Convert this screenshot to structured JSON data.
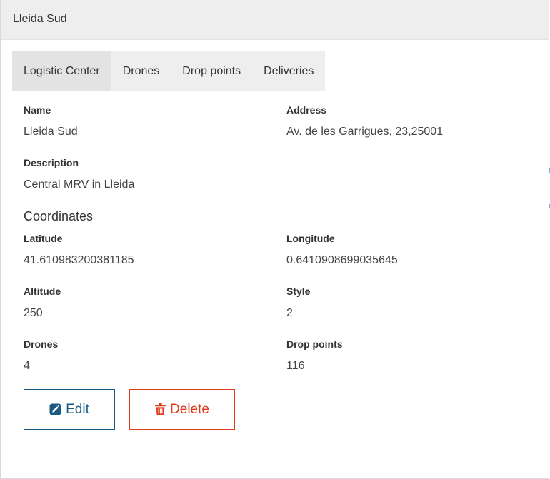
{
  "panel": {
    "title": "Lleida Sud"
  },
  "tabs": [
    {
      "label": "Logistic Center",
      "active": true
    },
    {
      "label": "Drones",
      "active": false
    },
    {
      "label": "Drop points",
      "active": false
    },
    {
      "label": "Deliveries",
      "active": false
    }
  ],
  "details": {
    "name_label": "Name",
    "name_value": "Lleida Sud",
    "address_label": "Address",
    "address_value": "Av. de les Garrigues, 23,25001",
    "description_label": "Description",
    "description_value": "Central MRV in Lleida"
  },
  "coordinates": {
    "section_title": "Coordinates",
    "latitude_label": "Latitude",
    "latitude_value": "41.610983200381185",
    "longitude_label": "Longitude",
    "longitude_value": "0.6410908699035645",
    "altitude_label": "Altitude",
    "altitude_value": "250",
    "style_label": "Style",
    "style_value": "2",
    "drones_label": "Drones",
    "drones_value": "4",
    "drop_points_label": "Drop points",
    "drop_points_value": "116"
  },
  "actions": {
    "edit_label": "Edit",
    "edit_icon": "pencil-square-icon",
    "delete_label": "Delete",
    "delete_icon": "trash-icon"
  },
  "colors": {
    "edit": "#1a5a82",
    "delete": "#dd3b1e",
    "header_bg": "#eeeeee"
  }
}
